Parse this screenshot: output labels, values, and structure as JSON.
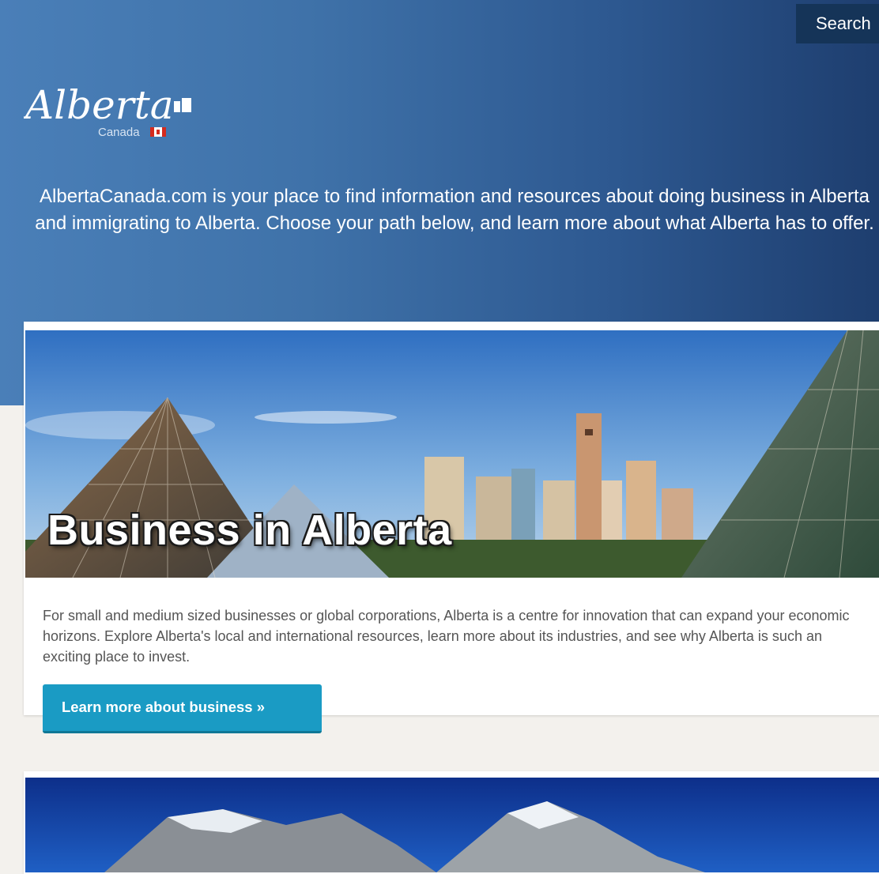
{
  "header": {
    "search_label": "Search",
    "logo": {
      "wordmark": "Alberta",
      "sub": "Canada"
    },
    "intro": "AlbertaCanada.com is your place to find information and resources about doing business in Alberta and immigrating to Alberta. Choose your path below, and learn more about what Alberta has to offer."
  },
  "business_card": {
    "banner_title": "Business in Alberta",
    "description": "For small and medium sized businesses or global corporations, Alberta is a centre for innovation that can expand your economic horizons.  Explore Alberta's local and international resources, learn more about its industries, and see why Alberta is such an exciting place to invest.",
    "cta_label": "Learn more about business »"
  },
  "colors": {
    "hero_left": "#4a7fb8",
    "hero_right": "#1e3e6f",
    "search_bg": "#153458",
    "cta_bg": "#1a9bc4",
    "page_bg": "#f3f1ed"
  }
}
